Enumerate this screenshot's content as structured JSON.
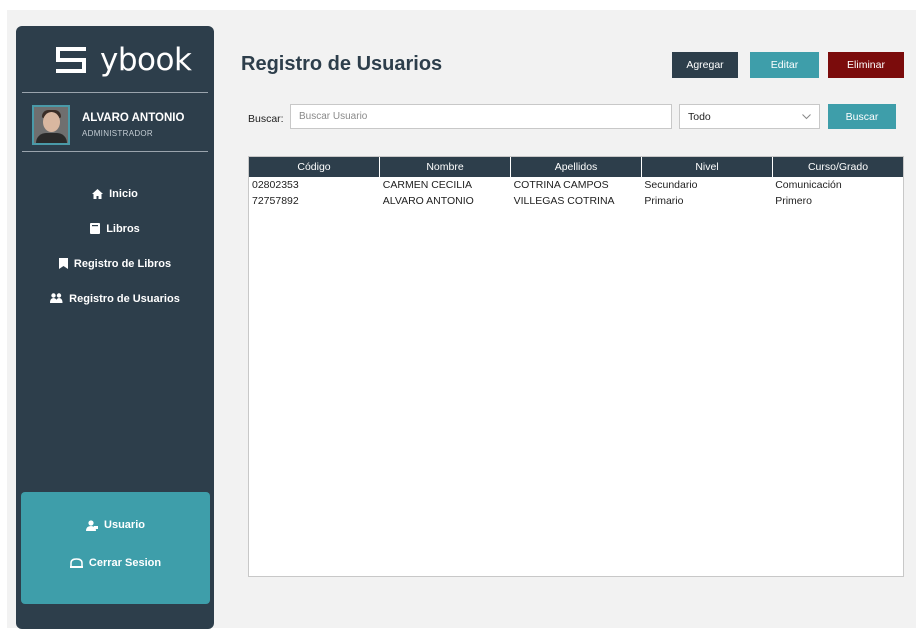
{
  "app": {
    "logo_text": "ybook"
  },
  "user": {
    "name": "ALVARO ANTONIO",
    "role": "ADMINISTRADOR"
  },
  "sidebar": {
    "items": [
      {
        "label": "Inicio",
        "icon": "home-icon"
      },
      {
        "label": "Libros",
        "icon": "book-icon"
      },
      {
        "label": "Registro de Libros",
        "icon": "bookmark-icon"
      },
      {
        "label": "Registro de Usuarios",
        "icon": "users-icon"
      }
    ],
    "bottom": [
      {
        "label": "Usuario",
        "icon": "user-icon"
      },
      {
        "label": "Cerrar Sesion",
        "icon": "logout-icon"
      }
    ]
  },
  "main": {
    "title": "Registro de Usuarios",
    "buttons": {
      "agregar": "Agregar",
      "editar": "Editar",
      "eliminar": "Eliminar"
    },
    "search": {
      "label": "Buscar:",
      "placeholder": "Buscar Usuario",
      "filter_value": "Todo",
      "button": "Buscar"
    },
    "table": {
      "columns": [
        "Código",
        "Nombre",
        "Apellidos",
        "Nivel",
        "Curso/Grado"
      ],
      "rows": [
        [
          "02802353",
          "CARMEN CECILIA",
          "COTRINA CAMPOS",
          "Secundario",
          "Comunicación"
        ],
        [
          "72757892",
          "ALVARO ANTONIO",
          "VILLEGAS COTRINA",
          "Primario",
          "Primero"
        ]
      ]
    }
  },
  "colors": {
    "sidebar": "#2d3e4b",
    "accent": "#3e9eaa",
    "danger": "#7b0c0c",
    "background": "#f2f2f2"
  }
}
